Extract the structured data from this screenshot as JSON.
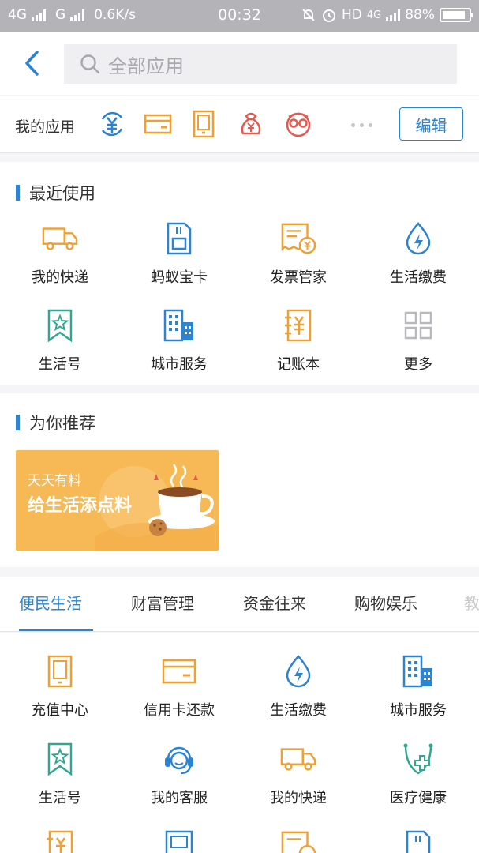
{
  "status_bar": {
    "network1": "4G",
    "network2": "G",
    "speed": "0.6K/s",
    "time": "00:32",
    "hd": "HD",
    "network3": "4G",
    "battery": "88%",
    "battery_level": 0.88
  },
  "search": {
    "placeholder": "全部应用"
  },
  "my_apps": {
    "label": "我的应用",
    "icons": [
      "yuan-circle-icon",
      "card-icon",
      "tablet-icon",
      "money-bag-icon",
      "glasses-face-icon"
    ],
    "edit_label": "编辑"
  },
  "recent": {
    "title": "最近使用",
    "items": [
      {
        "label": "我的快递",
        "icon": "truck-icon"
      },
      {
        "label": "蚂蚁宝卡",
        "icon": "sim-card-icon"
      },
      {
        "label": "发票管家",
        "icon": "invoice-icon"
      },
      {
        "label": "生活缴费",
        "icon": "water-drop-icon"
      },
      {
        "label": "生活号",
        "icon": "bookmark-star-icon"
      },
      {
        "label": "城市服务",
        "icon": "building-icon"
      },
      {
        "label": "记账本",
        "icon": "ledger-icon"
      },
      {
        "label": "更多",
        "icon": "grid-icon"
      }
    ]
  },
  "recommend": {
    "title": "为你推荐",
    "banner_line1": "天天有料",
    "banner_line2": "给生活添点料"
  },
  "tabs": [
    "便民生活",
    "财富管理",
    "资金往来",
    "购物娱乐",
    "教"
  ],
  "services": {
    "items": [
      {
        "label": "充值中心",
        "icon": "tablet-icon"
      },
      {
        "label": "信用卡还款",
        "icon": "card-icon"
      },
      {
        "label": "生活缴费",
        "icon": "water-drop-icon"
      },
      {
        "label": "城市服务",
        "icon": "building-icon"
      },
      {
        "label": "生活号",
        "icon": "bookmark-star-icon"
      },
      {
        "label": "我的客服",
        "icon": "headset-icon"
      },
      {
        "label": "我的快递",
        "icon": "truck-icon"
      },
      {
        "label": "医疗健康",
        "icon": "medical-shield-icon"
      }
    ]
  },
  "colors": {
    "accent": "#2b83d1",
    "orange": "#f0a030",
    "green": "#2fa88f",
    "red": "#e8584f"
  }
}
